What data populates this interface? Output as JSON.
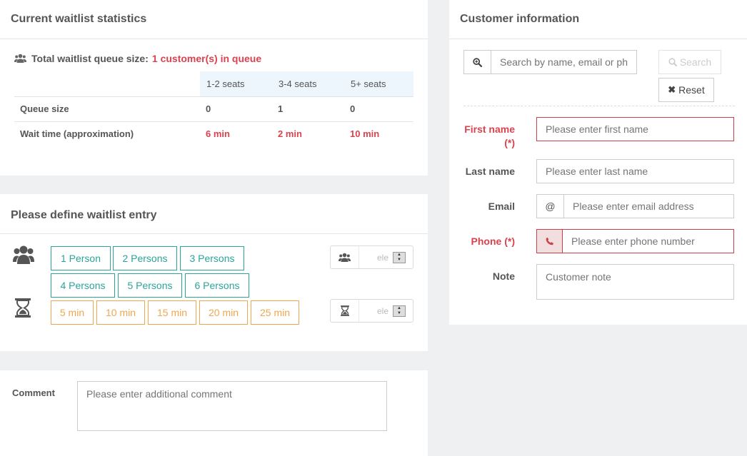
{
  "stats": {
    "title": "Current waitlist statistics",
    "queue_label": "Total waitlist queue size:",
    "queue_value": "1 customer(s) in queue",
    "columns": [
      "",
      "1-2 seats",
      "3-4 seats",
      "5+ seats"
    ],
    "rows": [
      {
        "label": "Queue size",
        "values": [
          "0",
          "1",
          "0"
        ]
      },
      {
        "label": "Wait time (approximation)",
        "values": [
          "6 min",
          "2 min",
          "10 min"
        ]
      }
    ]
  },
  "define": {
    "title": "Please define waitlist entry",
    "persons": [
      "1 Person",
      "2 Persons",
      "3 Persons",
      "4 Persons",
      "5 Persons",
      "6 Persons"
    ],
    "times": [
      "5 min",
      "10 min",
      "15 min",
      "20 min",
      "25 min"
    ],
    "persons_spinner_value": "ele",
    "time_spinner_value": "ele"
  },
  "comment": {
    "label": "Comment",
    "placeholder": "Please enter additional comment"
  },
  "customer": {
    "title": "Customer information",
    "search_placeholder": "Search by name, email or ph",
    "search_label": "Search",
    "reset_label": "Reset",
    "first_name_label": "First name",
    "required_mark": "(*)",
    "first_name_placeholder": "Please enter first name",
    "last_name_label": "Last name",
    "last_name_placeholder": "Please enter last name",
    "email_label": "Email",
    "email_addon": "@",
    "email_placeholder": "Please enter email address",
    "phone_label": "Phone (*)",
    "phone_placeholder": "Please enter phone number",
    "note_label": "Note",
    "note_placeholder": "Customer note"
  },
  "colors": {
    "accent_red": "#d9434e",
    "teal": "#2aa59a",
    "orange": "#f0a74d",
    "table_header_bg": "#edf5fd"
  }
}
